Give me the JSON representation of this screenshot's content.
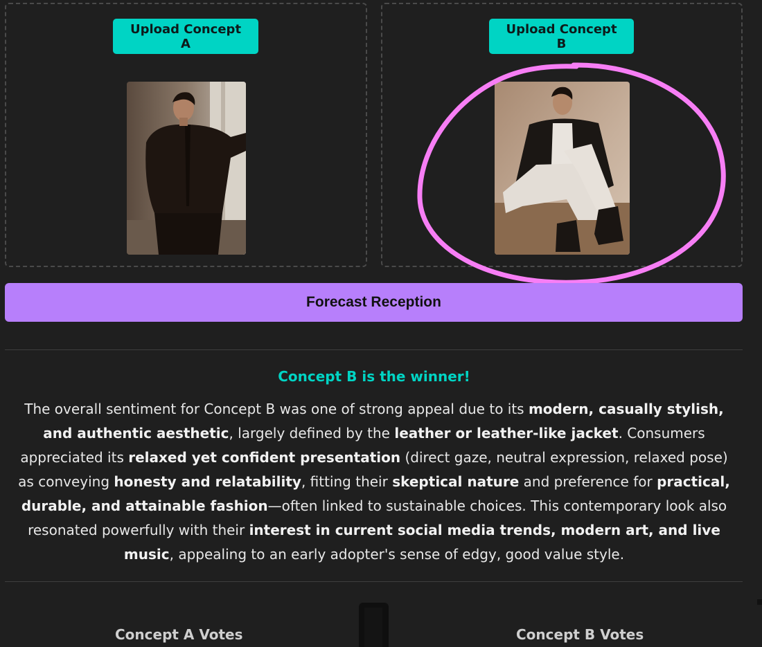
{
  "panels": {
    "a": {
      "upload_label": "Upload Concept A"
    },
    "b": {
      "upload_label": "Upload Concept B"
    }
  },
  "forecast_label": "Forecast Reception",
  "result": {
    "winner_title": "Concept B is the winner!",
    "segments": [
      {
        "text": "The overall sentiment for Concept B was one of strong appeal due to its ",
        "bold": false
      },
      {
        "text": "modern, casually stylish, and authentic aesthetic",
        "bold": true
      },
      {
        "text": ", largely defined by the ",
        "bold": false
      },
      {
        "text": "leather or leather-like jacket",
        "bold": true
      },
      {
        "text": ". Consumers appreciated its ",
        "bold": false
      },
      {
        "text": "relaxed yet confident presentation",
        "bold": true
      },
      {
        "text": " (direct gaze, neutral expression, relaxed pose) as conveying ",
        "bold": false
      },
      {
        "text": "honesty and relatability",
        "bold": true
      },
      {
        "text": ", fitting their ",
        "bold": false
      },
      {
        "text": "skeptical nature",
        "bold": true
      },
      {
        "text": " and preference for ",
        "bold": false
      },
      {
        "text": "practical, durable, and attainable fashion",
        "bold": true
      },
      {
        "text": "—often linked to sustainable choices. This contemporary look also resonated powerfully with their ",
        "bold": false
      },
      {
        "text": "interest in current social media trends, modern art, and live music",
        "bold": true
      },
      {
        "text": ", appealing to an early adopter's sense of edgy, good value style.",
        "bold": false
      }
    ]
  },
  "votes": {
    "a_label": "Concept A Votes",
    "b_label": "Concept B Votes"
  },
  "colors": {
    "accent_teal": "#00d4c4",
    "accent_purple": "#b77ffb",
    "highlight_pink": "#f77ef5",
    "background": "#1f1f1f"
  }
}
